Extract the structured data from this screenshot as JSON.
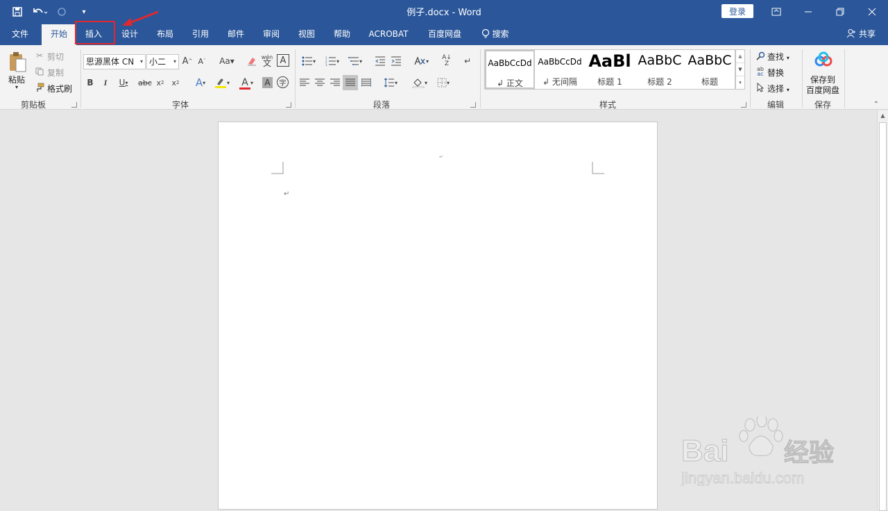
{
  "window": {
    "title": "例子.docx  -  Word",
    "login_label": "登录"
  },
  "tabs": [
    "文件",
    "开始",
    "插入",
    "设计",
    "布局",
    "引用",
    "邮件",
    "审阅",
    "视图",
    "帮助",
    "ACROBAT",
    "百度网盘"
  ],
  "tell_me": "搜索",
  "share_label": "共享",
  "clipboard": {
    "paste": "粘贴",
    "cut": "剪切",
    "copy": "复制",
    "format_painter": "格式刷",
    "group": "剪贴板"
  },
  "font": {
    "font_name": "思源黑体 CN",
    "font_size": "小二",
    "group": "字体",
    "phonetic": "wén"
  },
  "paragraph": {
    "group": "段落"
  },
  "styles": {
    "group": "样式",
    "items": [
      {
        "preview": "AaBbCcDd",
        "name": "正文"
      },
      {
        "preview": "AaBbCcDd",
        "name": "无间隔"
      },
      {
        "preview": "AaBl",
        "name": "标题 1"
      },
      {
        "preview": "AaBbC",
        "name": "标题 2"
      },
      {
        "preview": "AaBbC",
        "name": "标题"
      }
    ]
  },
  "editing": {
    "find": "查找",
    "replace": "替换",
    "select": "选择",
    "group": "编辑"
  },
  "save": {
    "save_to_line1": "保存到",
    "save_to_line2": "百度网盘",
    "group": "保存"
  },
  "watermark": {
    "brand": "Bai",
    "brand2": "经验",
    "url": "jingyan.baidu.com"
  },
  "colors": {
    "ribbon_blue": "#2b579a",
    "highlight_red": "#e0282e"
  }
}
